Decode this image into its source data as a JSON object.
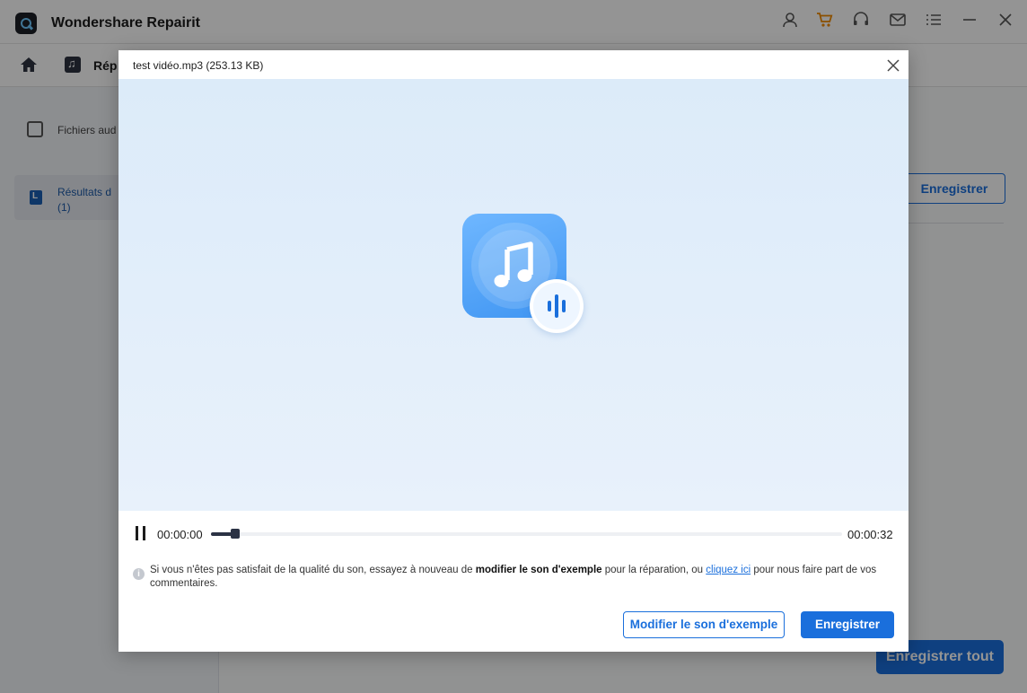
{
  "app": {
    "title": "Wondershare Repairit",
    "toolbar_icons": [
      "user-icon",
      "cart-icon",
      "headset-icon",
      "mail-icon",
      "menu-icon",
      "minimize-icon",
      "close-icon"
    ]
  },
  "nav": {
    "tab_label": "Rép"
  },
  "sidebar": {
    "items": [
      {
        "label": "Fichiers aud"
      },
      {
        "label": "Résultats d",
        "count": "(1)"
      }
    ]
  },
  "background": {
    "save_label": "Enregistrer",
    "save_all_label": "Enregistrer tout"
  },
  "modal": {
    "title": "test vidéo.mp3 (253.13  KB)",
    "player": {
      "current_time": "00:00:00",
      "total_time": "00:00:32",
      "progress": 0.035
    },
    "info": {
      "text_before": "Si vous n'êtes pas satisfait de la qualité du son, essayez à nouveau de ",
      "bold_text": "modifier le son d'exemple",
      "text_middle": " pour la réparation, ou ",
      "link_text": "cliquez ici",
      "text_after": " pour nous faire part de vos commentaires."
    },
    "modify_button": "Modifier le son d'exemple",
    "save_button": "Enregistrer"
  },
  "colors": {
    "accent": "#1a6fdc",
    "preview_bg": "#e3eefa",
    "icon_tile": "#4c9ef5"
  }
}
